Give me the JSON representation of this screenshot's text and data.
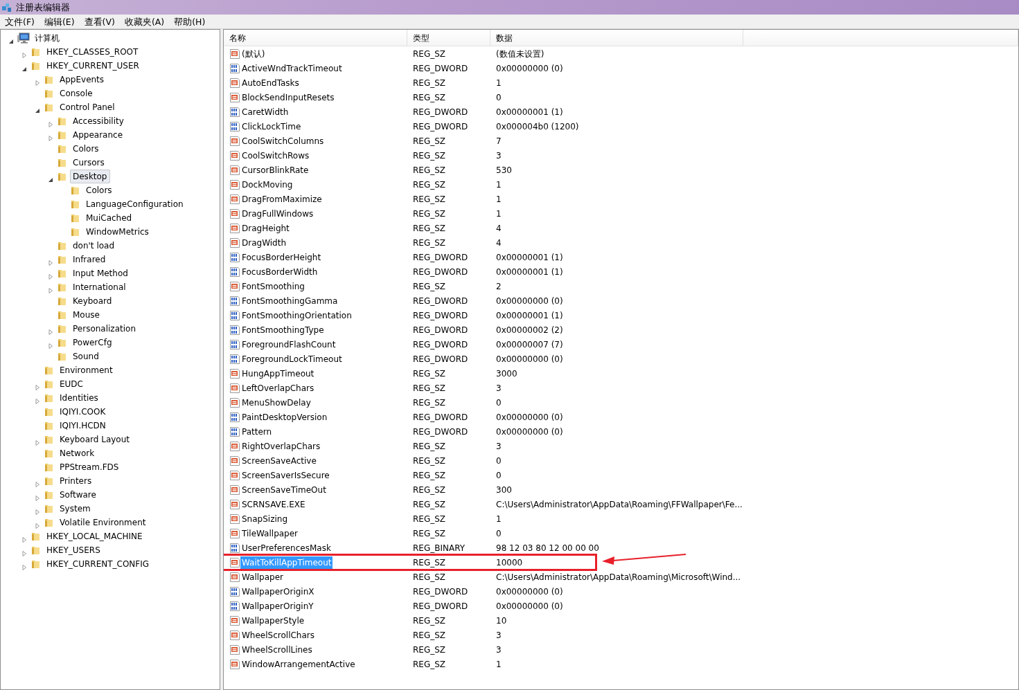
{
  "window": {
    "title": "注册表编辑器"
  },
  "menu": [
    "文件(F)",
    "编辑(E)",
    "查看(V)",
    "收藏夹(A)",
    "帮助(H)"
  ],
  "tree": [
    {
      "label": "计算机",
      "kind": "computer",
      "has_children": true,
      "expanded": true,
      "selected": false,
      "children": [
        {
          "label": "HKEY_CLASSES_ROOT",
          "has_children": true,
          "expanded": false,
          "selected": false
        },
        {
          "label": "HKEY_CURRENT_USER",
          "has_children": true,
          "expanded": true,
          "selected": false,
          "children": [
            {
              "label": "AppEvents",
              "has_children": true,
              "expanded": false,
              "selected": false
            },
            {
              "label": "Console",
              "has_children": false,
              "expanded": false,
              "selected": false
            },
            {
              "label": "Control Panel",
              "has_children": true,
              "expanded": true,
              "selected": false,
              "children": [
                {
                  "label": "Accessibility",
                  "has_children": true,
                  "expanded": false,
                  "selected": false
                },
                {
                  "label": "Appearance",
                  "has_children": true,
                  "expanded": false,
                  "selected": false
                },
                {
                  "label": "Colors",
                  "has_children": false,
                  "expanded": false,
                  "selected": false
                },
                {
                  "label": "Cursors",
                  "has_children": false,
                  "expanded": false,
                  "selected": false
                },
                {
                  "label": "Desktop",
                  "has_children": true,
                  "expanded": true,
                  "selected": true,
                  "children": [
                    {
                      "label": "Colors",
                      "has_children": false,
                      "expanded": false,
                      "selected": false
                    },
                    {
                      "label": "LanguageConfiguration",
                      "has_children": false,
                      "expanded": false,
                      "selected": false
                    },
                    {
                      "label": "MuiCached",
                      "has_children": false,
                      "expanded": false,
                      "selected": false
                    },
                    {
                      "label": "WindowMetrics",
                      "has_children": false,
                      "expanded": false,
                      "selected": false
                    }
                  ]
                },
                {
                  "label": "don't load",
                  "has_children": false,
                  "expanded": false,
                  "selected": false
                },
                {
                  "label": "Infrared",
                  "has_children": true,
                  "expanded": false,
                  "selected": false
                },
                {
                  "label": "Input Method",
                  "has_children": true,
                  "expanded": false,
                  "selected": false
                },
                {
                  "label": "International",
                  "has_children": true,
                  "expanded": false,
                  "selected": false
                },
                {
                  "label": "Keyboard",
                  "has_children": false,
                  "expanded": false,
                  "selected": false
                },
                {
                  "label": "Mouse",
                  "has_children": false,
                  "expanded": false,
                  "selected": false
                },
                {
                  "label": "Personalization",
                  "has_children": true,
                  "expanded": false,
                  "selected": false
                },
                {
                  "label": "PowerCfg",
                  "has_children": true,
                  "expanded": false,
                  "selected": false
                },
                {
                  "label": "Sound",
                  "has_children": false,
                  "expanded": false,
                  "selected": false
                }
              ]
            },
            {
              "label": "Environment",
              "has_children": false,
              "expanded": false,
              "selected": false
            },
            {
              "label": "EUDC",
              "has_children": true,
              "expanded": false,
              "selected": false
            },
            {
              "label": "Identities",
              "has_children": true,
              "expanded": false,
              "selected": false
            },
            {
              "label": "IQIYI.COOK",
              "has_children": false,
              "expanded": false,
              "selected": false
            },
            {
              "label": "IQIYI.HCDN",
              "has_children": false,
              "expanded": false,
              "selected": false
            },
            {
              "label": "Keyboard Layout",
              "has_children": true,
              "expanded": false,
              "selected": false
            },
            {
              "label": "Network",
              "has_children": false,
              "expanded": false,
              "selected": false
            },
            {
              "label": "PPStream.FDS",
              "has_children": false,
              "expanded": false,
              "selected": false
            },
            {
              "label": "Printers",
              "has_children": true,
              "expanded": false,
              "selected": false
            },
            {
              "label": "Software",
              "has_children": true,
              "expanded": false,
              "selected": false
            },
            {
              "label": "System",
              "has_children": true,
              "expanded": false,
              "selected": false
            },
            {
              "label": "Volatile Environment",
              "has_children": true,
              "expanded": false,
              "selected": false
            }
          ]
        },
        {
          "label": "HKEY_LOCAL_MACHINE",
          "has_children": true,
          "expanded": false,
          "selected": false
        },
        {
          "label": "HKEY_USERS",
          "has_children": true,
          "expanded": false,
          "selected": false
        },
        {
          "label": "HKEY_CURRENT_CONFIG",
          "has_children": true,
          "expanded": false,
          "selected": false
        }
      ]
    }
  ],
  "table": {
    "columns": [
      "名称",
      "类型",
      "数据"
    ],
    "rows": [
      {
        "kind": "string",
        "name": "(默认)",
        "type": "REG_SZ",
        "data": "(数值未设置)",
        "selected": false,
        "highlighted": false
      },
      {
        "kind": "binary",
        "name": "ActiveWndTrackTimeout",
        "type": "REG_DWORD",
        "data": "0x00000000 (0)",
        "selected": false,
        "highlighted": false
      },
      {
        "kind": "string",
        "name": "AutoEndTasks",
        "type": "REG_SZ",
        "data": "1",
        "selected": false,
        "highlighted": false
      },
      {
        "kind": "string",
        "name": "BlockSendInputResets",
        "type": "REG_SZ",
        "data": "0",
        "selected": false,
        "highlighted": false
      },
      {
        "kind": "binary",
        "name": "CaretWidth",
        "type": "REG_DWORD",
        "data": "0x00000001 (1)",
        "selected": false,
        "highlighted": false
      },
      {
        "kind": "binary",
        "name": "ClickLockTime",
        "type": "REG_DWORD",
        "data": "0x000004b0 (1200)",
        "selected": false,
        "highlighted": false
      },
      {
        "kind": "string",
        "name": "CoolSwitchColumns",
        "type": "REG_SZ",
        "data": "7",
        "selected": false,
        "highlighted": false
      },
      {
        "kind": "string",
        "name": "CoolSwitchRows",
        "type": "REG_SZ",
        "data": "3",
        "selected": false,
        "highlighted": false
      },
      {
        "kind": "string",
        "name": "CursorBlinkRate",
        "type": "REG_SZ",
        "data": "530",
        "selected": false,
        "highlighted": false
      },
      {
        "kind": "string",
        "name": "DockMoving",
        "type": "REG_SZ",
        "data": "1",
        "selected": false,
        "highlighted": false
      },
      {
        "kind": "string",
        "name": "DragFromMaximize",
        "type": "REG_SZ",
        "data": "1",
        "selected": false,
        "highlighted": false
      },
      {
        "kind": "string",
        "name": "DragFullWindows",
        "type": "REG_SZ",
        "data": "1",
        "selected": false,
        "highlighted": false
      },
      {
        "kind": "string",
        "name": "DragHeight",
        "type": "REG_SZ",
        "data": "4",
        "selected": false,
        "highlighted": false
      },
      {
        "kind": "string",
        "name": "DragWidth",
        "type": "REG_SZ",
        "data": "4",
        "selected": false,
        "highlighted": false
      },
      {
        "kind": "binary",
        "name": "FocusBorderHeight",
        "type": "REG_DWORD",
        "data": "0x00000001 (1)",
        "selected": false,
        "highlighted": false
      },
      {
        "kind": "binary",
        "name": "FocusBorderWidth",
        "type": "REG_DWORD",
        "data": "0x00000001 (1)",
        "selected": false,
        "highlighted": false
      },
      {
        "kind": "string",
        "name": "FontSmoothing",
        "type": "REG_SZ",
        "data": "2",
        "selected": false,
        "highlighted": false
      },
      {
        "kind": "binary",
        "name": "FontSmoothingGamma",
        "type": "REG_DWORD",
        "data": "0x00000000 (0)",
        "selected": false,
        "highlighted": false
      },
      {
        "kind": "binary",
        "name": "FontSmoothingOrientation",
        "type": "REG_DWORD",
        "data": "0x00000001 (1)",
        "selected": false,
        "highlighted": false
      },
      {
        "kind": "binary",
        "name": "FontSmoothingType",
        "type": "REG_DWORD",
        "data": "0x00000002 (2)",
        "selected": false,
        "highlighted": false
      },
      {
        "kind": "binary",
        "name": "ForegroundFlashCount",
        "type": "REG_DWORD",
        "data": "0x00000007 (7)",
        "selected": false,
        "highlighted": false
      },
      {
        "kind": "binary",
        "name": "ForegroundLockTimeout",
        "type": "REG_DWORD",
        "data": "0x00000000 (0)",
        "selected": false,
        "highlighted": false
      },
      {
        "kind": "string",
        "name": "HungAppTimeout",
        "type": "REG_SZ",
        "data": "3000",
        "selected": false,
        "highlighted": false
      },
      {
        "kind": "string",
        "name": "LeftOverlapChars",
        "type": "REG_SZ",
        "data": "3",
        "selected": false,
        "highlighted": false
      },
      {
        "kind": "string",
        "name": "MenuShowDelay",
        "type": "REG_SZ",
        "data": "0",
        "selected": false,
        "highlighted": false
      },
      {
        "kind": "binary",
        "name": "PaintDesktopVersion",
        "type": "REG_DWORD",
        "data": "0x00000000 (0)",
        "selected": false,
        "highlighted": false
      },
      {
        "kind": "binary",
        "name": "Pattern",
        "type": "REG_DWORD",
        "data": "0x00000000 (0)",
        "selected": false,
        "highlighted": false
      },
      {
        "kind": "string",
        "name": "RightOverlapChars",
        "type": "REG_SZ",
        "data": "3",
        "selected": false,
        "highlighted": false
      },
      {
        "kind": "string",
        "name": "ScreenSaveActive",
        "type": "REG_SZ",
        "data": "0",
        "selected": false,
        "highlighted": false
      },
      {
        "kind": "string",
        "name": "ScreenSaverIsSecure",
        "type": "REG_SZ",
        "data": "0",
        "selected": false,
        "highlighted": false
      },
      {
        "kind": "string",
        "name": "ScreenSaveTimeOut",
        "type": "REG_SZ",
        "data": "300",
        "selected": false,
        "highlighted": false
      },
      {
        "kind": "string",
        "name": "SCRNSAVE.EXE",
        "type": "REG_SZ",
        "data": "C:\\Users\\Administrator\\AppData\\Roaming\\FFWallpaper\\Fe...",
        "selected": false,
        "highlighted": false
      },
      {
        "kind": "string",
        "name": "SnapSizing",
        "type": "REG_SZ",
        "data": "1",
        "selected": false,
        "highlighted": false
      },
      {
        "kind": "string",
        "name": "TileWallpaper",
        "type": "REG_SZ",
        "data": "0",
        "selected": false,
        "highlighted": false
      },
      {
        "kind": "binary",
        "name": "UserPreferencesMask",
        "type": "REG_BINARY",
        "data": "98 12 03 80 12 00 00 00",
        "selected": false,
        "highlighted": false
      },
      {
        "kind": "string",
        "name": "WaitToKillAppTimeout",
        "type": "REG_SZ",
        "data": "10000",
        "selected": true,
        "highlighted": true
      },
      {
        "kind": "string",
        "name": "Wallpaper",
        "type": "REG_SZ",
        "data": "C:\\Users\\Administrator\\AppData\\Roaming\\Microsoft\\Wind...",
        "selected": false,
        "highlighted": false
      },
      {
        "kind": "binary",
        "name": "WallpaperOriginX",
        "type": "REG_DWORD",
        "data": "0x00000000 (0)",
        "selected": false,
        "highlighted": false
      },
      {
        "kind": "binary",
        "name": "WallpaperOriginY",
        "type": "REG_DWORD",
        "data": "0x00000000 (0)",
        "selected": false,
        "highlighted": false
      },
      {
        "kind": "string",
        "name": "WallpaperStyle",
        "type": "REG_SZ",
        "data": "10",
        "selected": false,
        "highlighted": false
      },
      {
        "kind": "string",
        "name": "WheelScrollChars",
        "type": "REG_SZ",
        "data": "3",
        "selected": false,
        "highlighted": false
      },
      {
        "kind": "string",
        "name": "WheelScrollLines",
        "type": "REG_SZ",
        "data": "3",
        "selected": false,
        "highlighted": false
      },
      {
        "kind": "string",
        "name": "WindowArrangementActive",
        "type": "REG_SZ",
        "data": "1",
        "selected": false,
        "highlighted": false
      }
    ]
  }
}
